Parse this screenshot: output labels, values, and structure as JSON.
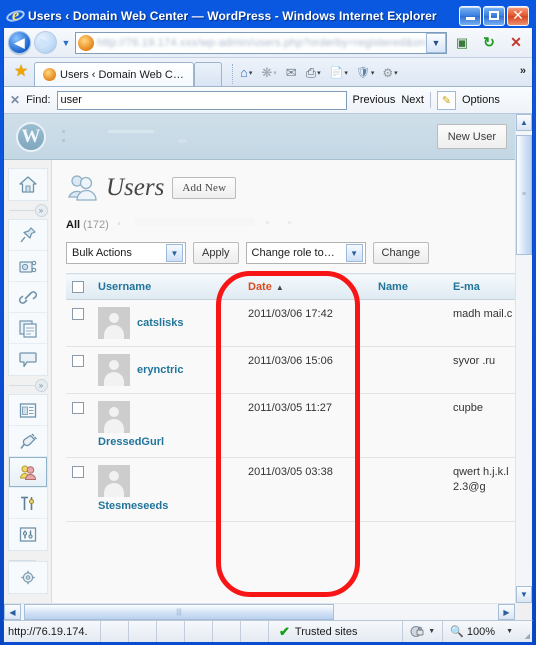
{
  "window": {
    "title": "Users ‹ Domain Web Center — WordPress - Windows Internet Explorer",
    "minimize_label": "Minimize",
    "maximize_label": "Maximize",
    "close_label": "✕",
    "app_icon": "internet-explorer-icon"
  },
  "addressbar": {
    "back_glyph": "◀",
    "forward_glyph": "▶",
    "history_glyph": "▼",
    "url_text": "http://76.19.174.xxx/wp-admin/users.php?orderby=registered&order=asc",
    "go_glyph": "▣",
    "refresh_glyph": "↻",
    "stop_glyph": "✕",
    "dropdown_glyph": "▼"
  },
  "tabs": {
    "favorites_star": "★",
    "items": [
      {
        "label": "Users ‹ Domain Web Cent…",
        "active": true
      }
    ],
    "new_tab_label": "",
    "toolbar_icons": [
      {
        "name": "home-icon",
        "glyph": "⌂"
      },
      {
        "name": "feeds-icon",
        "glyph": "❋"
      },
      {
        "name": "mail-icon",
        "glyph": "✉"
      },
      {
        "name": "print-icon",
        "glyph": "⎙"
      },
      {
        "name": "page-icon",
        "glyph": "📄"
      },
      {
        "name": "safety-icon",
        "glyph": "🛡"
      },
      {
        "name": "tools-icon",
        "glyph": "⚙"
      }
    ],
    "overflow_label": "»"
  },
  "findbar": {
    "close_glyph": "✕",
    "label": "Find:",
    "value": "user",
    "placeholder": "",
    "previous_label": "Previous",
    "next_label": "Next",
    "highlight_glyph": "✎",
    "options_label": "Options"
  },
  "wp_header": {
    "logo_letter": "W",
    "new_user_label": "New User"
  },
  "sidebar": {
    "groups": [
      {
        "items": [
          {
            "name": "dashboard",
            "icon": "house-icon",
            "glyph": "⌂",
            "current": false
          }
        ]
      },
      {
        "items": [
          {
            "name": "posts",
            "icon": "pin-icon",
            "glyph": "📌",
            "current": false
          },
          {
            "name": "media",
            "icon": "camera-icon",
            "glyph": "📷",
            "current": false
          },
          {
            "name": "links",
            "icon": "link-icon",
            "glyph": "🔗",
            "current": false
          },
          {
            "name": "pages",
            "icon": "pages-icon",
            "glyph": "📰",
            "current": false
          },
          {
            "name": "comments",
            "icon": "comment-bubble-icon",
            "glyph": "💬",
            "current": false
          }
        ]
      },
      {
        "items": [
          {
            "name": "appearance",
            "icon": "layout-icon",
            "glyph": "🖼",
            "current": false
          },
          {
            "name": "plugins",
            "icon": "plug-icon",
            "glyph": "🔌",
            "current": false
          },
          {
            "name": "users",
            "icon": "users-icon",
            "glyph": "👥",
            "current": true
          },
          {
            "name": "tools",
            "icon": "tools-icon",
            "glyph": "🛠",
            "current": false
          },
          {
            "name": "settings",
            "icon": "sliders-icon",
            "glyph": "🎚",
            "current": false
          }
        ]
      },
      {
        "items": [
          {
            "name": "extra-settings",
            "icon": "gear-icon",
            "glyph": "⚙",
            "current": false
          }
        ]
      }
    ],
    "collapse_glyph": "»"
  },
  "page": {
    "title": "Users",
    "title_icon": "users-icon",
    "add_new_label": "Add New",
    "filter_all_label": "All",
    "filter_all_count": "(172)"
  },
  "tablenav": {
    "bulk_actions_label": "Bulk Actions",
    "apply_label": "Apply",
    "change_role_label": "Change role to…",
    "change_label": "Change",
    "select_arrow": "▼"
  },
  "table": {
    "columns": [
      {
        "key": "cb",
        "label": ""
      },
      {
        "key": "username",
        "label": "Username",
        "sorted": false
      },
      {
        "key": "date",
        "label": "Date",
        "sorted": true,
        "sort_caret": "▲"
      },
      {
        "key": "name",
        "label": "Name",
        "sorted": false
      },
      {
        "key": "email",
        "label": "E-ma",
        "sorted": false
      }
    ],
    "rows": [
      {
        "username": "catslisks",
        "username_wraps": false,
        "date": "2011/03/06 17:42",
        "name": "",
        "email": "madh mail.c",
        "alt": true
      },
      {
        "username": "erynctric",
        "username_wraps": false,
        "date": "2011/03/06 15:06",
        "name": "",
        "email": "syvor .ru",
        "alt": false
      },
      {
        "username": "DressedGurl",
        "username_wraps": true,
        "date": "2011/03/05 11:27",
        "name": "",
        "email": "cupbe",
        "alt": true
      },
      {
        "username": "Stesmeseeds",
        "username_wraps": true,
        "date": "2011/03/05 03:38",
        "name": "",
        "email": "qwert h.j.k.l 2.3@g",
        "alt": false
      }
    ]
  },
  "annotation": {
    "shape": "red-rounded-rectangle",
    "target_column": "Date",
    "color": "#f71515"
  },
  "scrollbars": {
    "up_glyph": "▲",
    "down_glyph": "▼",
    "left_glyph": "◀",
    "right_glyph": "▶",
    "grip_glyph": "⦀"
  },
  "statusbar": {
    "url": "http://76.19.174.",
    "zone_check": "✔",
    "zone_label": "Trusted sites",
    "protected_icon": "protected-mode-icon",
    "zoom_icon": "zoom-magnifier-icon",
    "zoom_level": "100%",
    "caret": "▼",
    "grip": "◢"
  },
  "colors": {
    "titlebar_blue": "#0a50d4",
    "wp_link": "#21759b",
    "wp_sorted": "#d54e21",
    "annotation_red": "#f71515",
    "trusted_green": "#14a014"
  }
}
